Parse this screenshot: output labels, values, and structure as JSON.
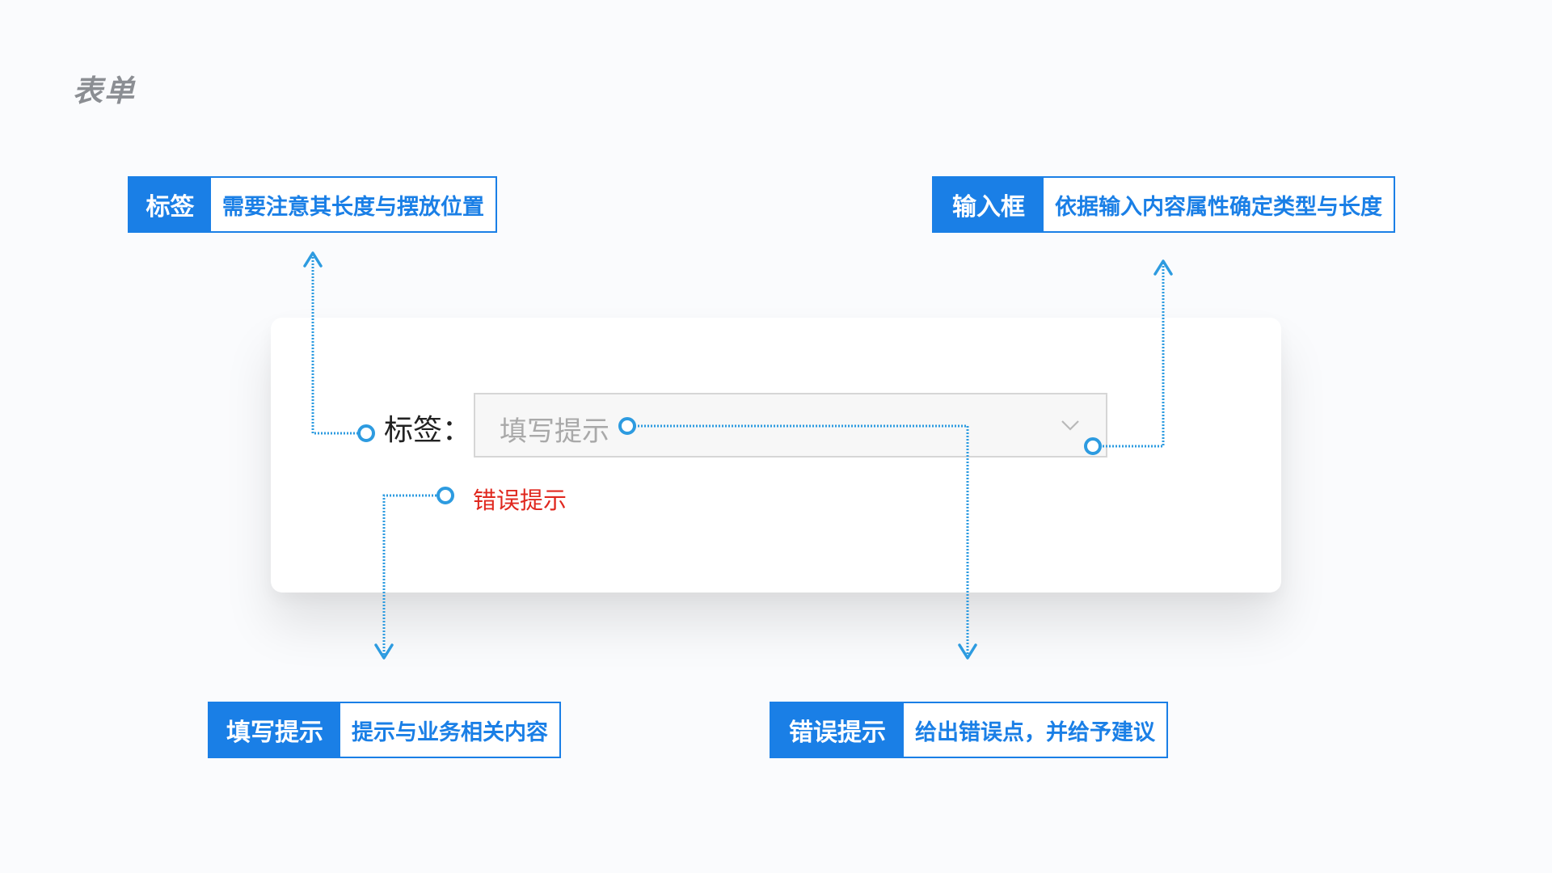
{
  "page": {
    "title": "表单"
  },
  "callouts": {
    "label": {
      "tag": "标签",
      "desc": "需要注意其长度与摆放位置"
    },
    "input": {
      "tag": "输入框",
      "desc": "依据输入内容属性确定类型与长度"
    },
    "placeholder": {
      "tag": "填写提示",
      "desc": "提示与业务相关内容"
    },
    "error": {
      "tag": "错误提示",
      "desc": "给出错误点，并给予建议"
    }
  },
  "form": {
    "label": "标签：",
    "placeholder": "填写提示",
    "error": "错误提示"
  },
  "colors": {
    "accent": "#1a7fe6",
    "connector": "#2d9be0",
    "error": "#e0281f",
    "placeholder": "#a9a9a9"
  },
  "icons": {
    "dropdown": "chevron-down-icon",
    "marker": "circle-marker-icon"
  }
}
